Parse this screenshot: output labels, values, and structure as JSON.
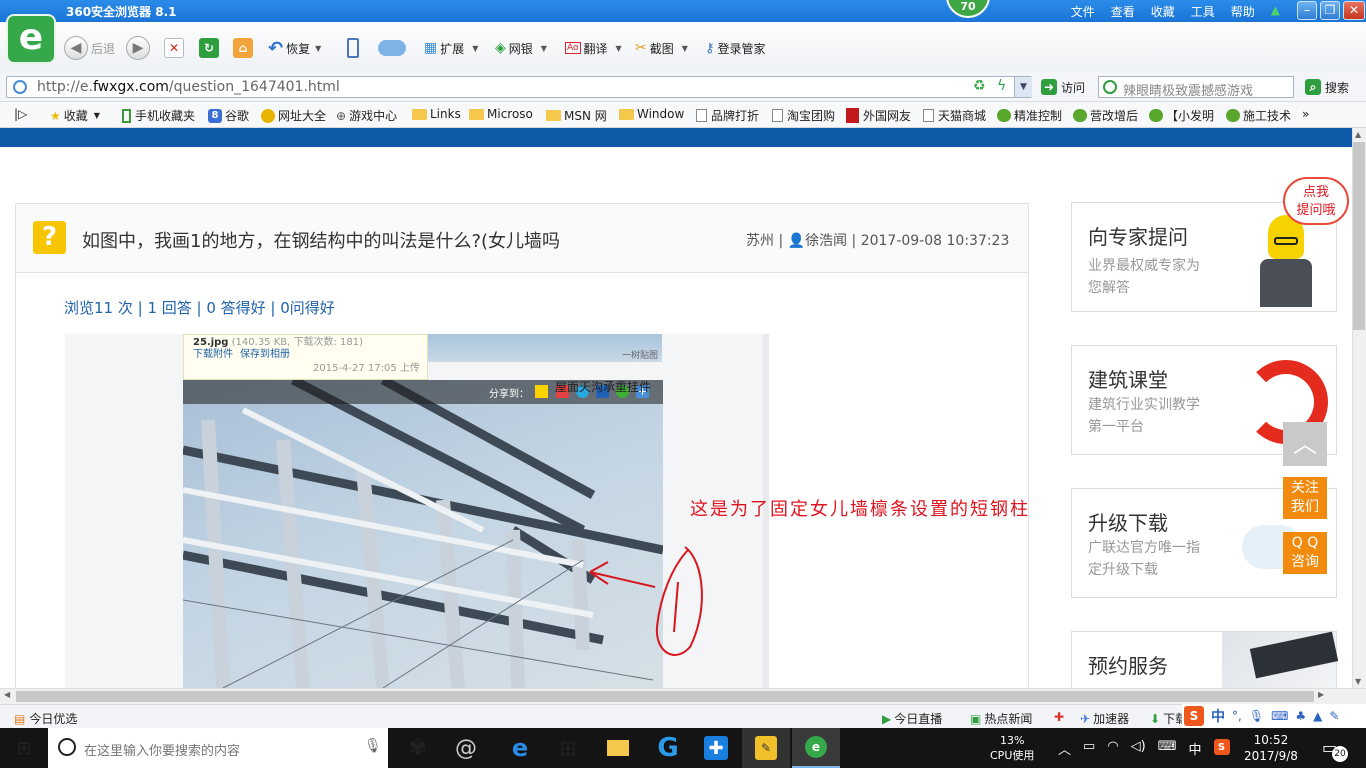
{
  "titlebar": {
    "title": "360安全浏览器 8.1",
    "badge": "70",
    "menus": [
      "文件",
      "查看",
      "收藏",
      "工具",
      "帮助"
    ]
  },
  "toolbar": {
    "back": "后退",
    "restore": "恢复",
    "extend": "扩展",
    "bank": "网银",
    "translate": "翻译",
    "screenshot": "截图",
    "login_manager": "登录管家"
  },
  "address": {
    "url_prefix": "http://e.",
    "url_domain": "fwxgx.com",
    "url_path": "/question_1647401.html",
    "go": "访问",
    "search_placeholder": "辣眼睛极致震撼感游戏",
    "search_button": "搜索"
  },
  "bookmarks": [
    "收藏",
    "手机收藏夹",
    "谷歌",
    "网址大全",
    "游戏中心",
    "Links",
    "Microso",
    "MSN 网",
    "Window",
    "品牌打折",
    "淘宝团购",
    "外国网友",
    "天猫商城",
    "精准控制",
    "营改增后",
    "【小发明",
    "施工技术"
  ],
  "question": {
    "title": "如图中，我画1的地方，在钢结构中的叫法是什么?(女儿墙吗",
    "location": "苏州",
    "author": "徐浩闻",
    "datetime": "2017-09-08 10:37:23",
    "stats": "浏览11 次 | 1 回答 | 0 答得好 | 0问得好"
  },
  "image": {
    "file_name": "25.jpg",
    "file_meta": "(140.35 KB, 下载次数: 181)",
    "download": "下载附件",
    "save": "保存到相册",
    "upload_time": "2015-4-27 17:05 上传",
    "caption": "屋面天沟承重挂件",
    "share_label": "分享到：",
    "top_right_label": "一树贴图",
    "annotation": "这是为了固定女儿墙檩条设置的短钢柱"
  },
  "sidebar": {
    "bubble": "点我\n提问哦",
    "cards": [
      {
        "title": "向专家提问",
        "sub": "业界最权威专家为您解答"
      },
      {
        "title": "建筑课堂",
        "sub": "建筑行业实训教学第一平台"
      },
      {
        "title": "升级下载",
        "sub": "广联达官方唯一指定升级下载"
      },
      {
        "title": "预约服务",
        "sub": ""
      }
    ],
    "follow": "关注\n我们",
    "qq": "Q Q\n咨询"
  },
  "status": {
    "today_pick": "今日优选",
    "live": "今日直播",
    "hot_news": "热点新闻",
    "accelerator": "加速器",
    "download": "下载",
    "ime": "中"
  },
  "taskbar": {
    "search_placeholder": "在这里输入你要搜索的内容",
    "cpu_percent": "13%",
    "cpu_label": "CPU使用",
    "ime": "中",
    "time": "10:52",
    "date": "2017/9/8",
    "notify_count": "20"
  },
  "colors": {
    "browser_blue": "#1a74d6",
    "site_blue": "#0d5ba8",
    "link_blue": "#1f62a8",
    "question_yellow": "#f7c600",
    "annotation_red": "#e0141e",
    "float_orange": "#f28a0d"
  }
}
